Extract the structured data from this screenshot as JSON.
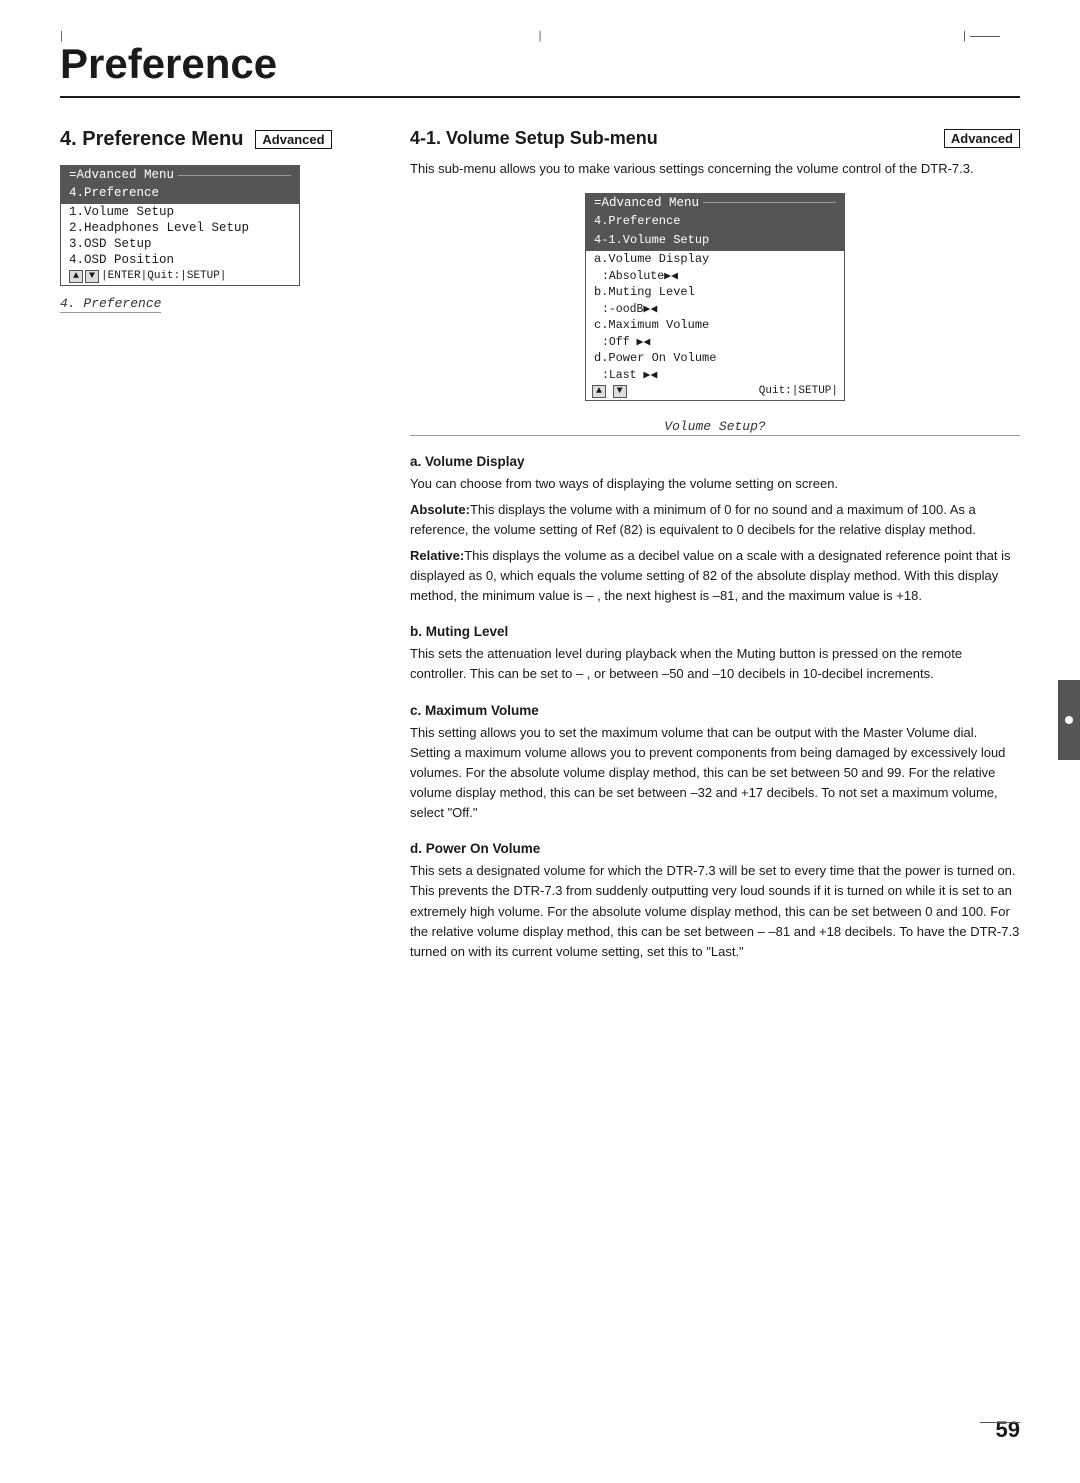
{
  "page": {
    "title": "Preference",
    "number": "59"
  },
  "left": {
    "section_heading": "4. Preference Menu",
    "advanced_badge": "Advanced",
    "menu": {
      "title": "=Advanced Menu",
      "highlighted_item": "4.Preference",
      "items": [
        "1.Volume Setup",
        "2.Headphones Level Setup",
        "3.OSD Setup",
        "4.OSD Position"
      ],
      "controls": "▲▼ ENTER Quit: SETUP"
    },
    "caption": "4. Preference"
  },
  "right": {
    "section_heading": "4-1. Volume Setup Sub-menu",
    "advanced_badge": "Advanced",
    "intro": "This sub-menu allows you to make various settings concerning the volume control of the DTR-7.3.",
    "menu": {
      "title": "=Advanced Menu",
      "item1": "4.Preference",
      "item2": "4-1.Volume Setup",
      "rows": [
        {
          "label": "a.Volume Display",
          "value": ""
        },
        {
          "label": "",
          "value": ":Absolute▶◀"
        },
        {
          "label": "b.Muting Level",
          "value": ""
        },
        {
          "label": "",
          "value": ":-oodB▶◀"
        },
        {
          "label": "c.Maximum Volume",
          "value": ""
        },
        {
          "label": "",
          "value": ":Off  ▶◀"
        },
        {
          "label": "d.Power On Volume",
          "value": ""
        },
        {
          "label": "",
          "value": ":Last ▶◀"
        }
      ],
      "controls_left": "▲▼",
      "controls_right": "Quit: SETUP"
    },
    "caption": "Volume Setup?",
    "sections": [
      {
        "id": "a",
        "heading": "a. Volume Display",
        "paragraphs": [
          "You can choose from two ways of displaying the volume setting on screen.",
          "**Absolute:**This displays the volume with a minimum of 0 for no sound and a maximum of 100. As a reference, the volume setting of Ref (82) is equivalent to 0 decibels for the relative display method.",
          "**Relative:**This displays the volume as a decibel value on a scale with a designated reference point that is displayed as 0, which equals the volume setting of 82 of the absolute display method. With this display method, the minimum value is –  , the next highest is –81, and the maximum value is +18."
        ]
      },
      {
        "id": "b",
        "heading": "b. Muting Level",
        "paragraphs": [
          "This sets the attenuation level during playback when the Muting button is pressed on the remote controller. This can be set to –  , or between –50 and –10 decibels in 10-decibel increments."
        ]
      },
      {
        "id": "c",
        "heading": "c. Maximum Volume",
        "paragraphs": [
          "This setting allows you to set the maximum volume that can be output with the Master Volume dial. Setting a maximum volume allows you to prevent components from being damaged by excessively loud volumes. For the absolute volume display method, this can be set between 50 and 99. For the relative volume display method, this can be set between –32 and +17 decibels. To not set a maximum volume, select \"Off.\""
        ]
      },
      {
        "id": "d",
        "heading": "d. Power On Volume",
        "paragraphs": [
          "This sets a designated volume for which the DTR-7.3 will be set to every time that the power is turned on. This prevents the DTR-7.3 from suddenly outputting very loud sounds if it is turned on while it is set to an extremely high volume. For the absolute volume display method, this can be set between 0 and 100. For the relative volume display method, this can be set between –   –81 and +18 decibels. To have the DTR-7.3 turned on with its current volume setting, set this to \"Last.\""
        ]
      }
    ]
  }
}
